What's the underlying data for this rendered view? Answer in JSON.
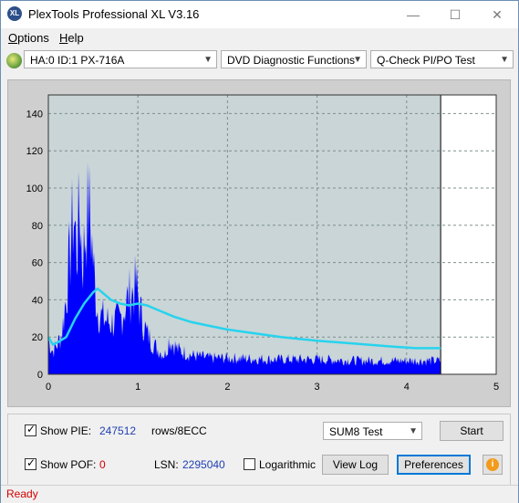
{
  "window": {
    "title": "PlexTools Professional XL V3.16",
    "icon_text": "XL",
    "minimize_glyph": "—",
    "maximize_glyph": "☐",
    "close_glyph": "✕"
  },
  "menu": {
    "options_rest": "ptions",
    "options_accel": "O",
    "help_rest": "elp",
    "help_accel": "H"
  },
  "toolbar": {
    "drive": "HA:0 ID:1  PX-716A",
    "function": "DVD Diagnostic Functions",
    "test": "Q-Check PI/PO Test"
  },
  "chart_data": {
    "type": "area",
    "x_ticks": [
      "0",
      "1",
      "2",
      "3",
      "4",
      "5"
    ],
    "y_ticks": [
      "0",
      "20",
      "40",
      "60",
      "80",
      "100",
      "120",
      "140"
    ],
    "xlim": [
      0,
      5
    ],
    "ylim": [
      0,
      150
    ],
    "grid": true,
    "end_marker_x": 4.38,
    "colors": {
      "pie_fill": "#0000ff",
      "avg_line": "#27d3ee",
      "plot_bg": "#c9d5d6",
      "empty_area": "#ffffff"
    },
    "series": [
      {
        "kind": "bars",
        "x": [
          0.0,
          0.05,
          0.1,
          0.15,
          0.2,
          0.25,
          0.28,
          0.32,
          0.35,
          0.38,
          0.42,
          0.45,
          0.48,
          0.52,
          0.55,
          0.6,
          0.7,
          0.8,
          0.9,
          0.95,
          0.98,
          1.02,
          1.05,
          1.1,
          1.15,
          1.2,
          1.3,
          1.35,
          1.45,
          1.6,
          1.8,
          2.0,
          2.5,
          3.0,
          3.5,
          4.0,
          4.38
        ],
        "values": [
          25,
          17,
          22,
          30,
          58,
          95,
          120,
          90,
          127,
          80,
          110,
          125,
          105,
          65,
          48,
          42,
          38,
          40,
          58,
          62,
          66,
          50,
          40,
          30,
          25,
          20,
          14,
          26,
          18,
          14,
          12,
          12,
          11,
          11,
          10,
          10,
          10
        ]
      },
      {
        "kind": "line",
        "x": [
          0.0,
          0.05,
          0.1,
          0.2,
          0.3,
          0.4,
          0.5,
          0.55,
          0.6,
          0.7,
          0.8,
          0.9,
          1.0,
          1.1,
          1.2,
          1.4,
          1.6,
          1.8,
          2.0,
          2.3,
          2.6,
          3.0,
          3.4,
          3.8,
          4.1,
          4.38
        ],
        "values": [
          20,
          16,
          17,
          20,
          30,
          38,
          44,
          46,
          44,
          40,
          38,
          37,
          38,
          37,
          35,
          31,
          28,
          26,
          24,
          22,
          20,
          18,
          16.5,
          15,
          14,
          14
        ]
      }
    ]
  },
  "controls": {
    "show_pie_label": "Show PIE:",
    "pie_value": "247512",
    "pie_unit": "rows/8ECC",
    "show_pof_label": "Show POF:",
    "pof_value": "0",
    "lsn_label": "LSN:",
    "lsn_value": "2295040",
    "logarithmic_label": "Logarithmic",
    "test_mode": "SUM8 Test",
    "start_label": "Start",
    "view_log_label": "View Log",
    "preferences_label": "Preferences",
    "info_glyph": "i",
    "check_glyph": "✓"
  },
  "status": {
    "text": "Ready"
  }
}
